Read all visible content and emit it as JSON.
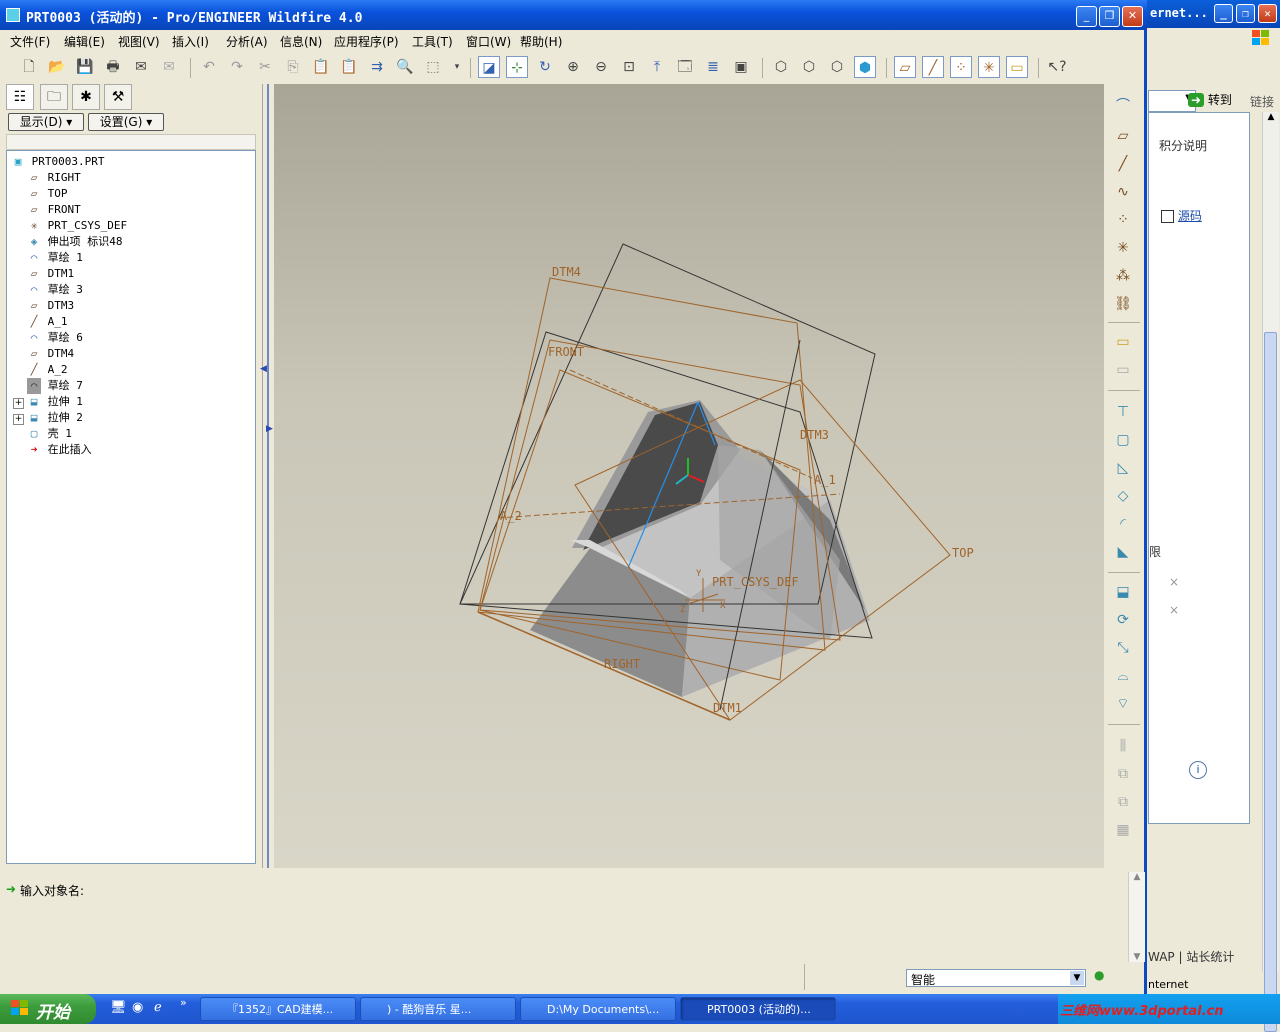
{
  "window": {
    "title": "PRT0003 (活动的) - Pro/ENGINEER Wildfire 4.0"
  },
  "menu": [
    "文件(F)",
    "编辑(E)",
    "视图(V)",
    "插入(I)",
    "分析(A)",
    "信息(N)",
    "应用程序(P)",
    "工具(T)",
    "窗口(W)",
    "帮助(H)"
  ],
  "tree": {
    "display_button": "显示(D)",
    "settings_button": "设置(G)",
    "items": [
      {
        "label": "PRT0003.PRT",
        "icon": "part-icon"
      },
      {
        "label": "RIGHT",
        "icon": "datum-plane-icon"
      },
      {
        "label": "TOP",
        "icon": "datum-plane-icon"
      },
      {
        "label": "FRONT",
        "icon": "datum-plane-icon"
      },
      {
        "label": "PRT_CSYS_DEF",
        "icon": "csys-icon"
      },
      {
        "label": "伸出项 标识48",
        "icon": "protrusion-icon"
      },
      {
        "label": "草绘 1",
        "icon": "sketch-icon"
      },
      {
        "label": "DTM1",
        "icon": "datum-plane-icon"
      },
      {
        "label": "草绘 3",
        "icon": "sketch-icon"
      },
      {
        "label": "DTM3",
        "icon": "datum-plane-icon"
      },
      {
        "label": "A_1",
        "icon": "axis-icon"
      },
      {
        "label": "草绘 6",
        "icon": "sketch-icon"
      },
      {
        "label": "DTM4",
        "icon": "datum-plane-icon"
      },
      {
        "label": "A_2",
        "icon": "axis-icon"
      },
      {
        "label": "草绘 7",
        "icon": "sketch-icon"
      },
      {
        "label": "拉伸 1",
        "icon": "extrude-icon"
      },
      {
        "label": "拉伸 2",
        "icon": "extrude-icon"
      },
      {
        "label": "壳 1",
        "icon": "shell-icon"
      },
      {
        "label": "在此插入",
        "icon": "insert-arrow-icon"
      }
    ]
  },
  "graphics": {
    "labels": {
      "dtm4": "DTM4",
      "front": "FRONT",
      "dtm3": "DTM3",
      "a1": "A_1",
      "a2": "A_2",
      "top": "TOP",
      "csys": "PRT_CSYS_DEF",
      "right": "RIGHT",
      "dtm1": "DTM1",
      "x": "X",
      "y": "Y",
      "z": "Z"
    }
  },
  "message": {
    "prompt": "输入对象名:"
  },
  "status": {
    "filter_value": "智能"
  },
  "background_window": {
    "title": "ernet...",
    "goto_label": "转到",
    "links_label": "链接",
    "integral_label": "积分说明",
    "source_label": "源码",
    "limit_label": "限",
    "footer_links": "WAP | 站长统计",
    "status": "nternet"
  },
  "taskbar": {
    "start_label": "开始",
    "tasks": [
      "『1352』CAD建模...",
      ") - 酷狗音乐 星...",
      "D:\\My Documents\\...",
      "PRT0003 (活动的)..."
    ],
    "tray_watermark": "三维网www.3dportal.cn"
  }
}
